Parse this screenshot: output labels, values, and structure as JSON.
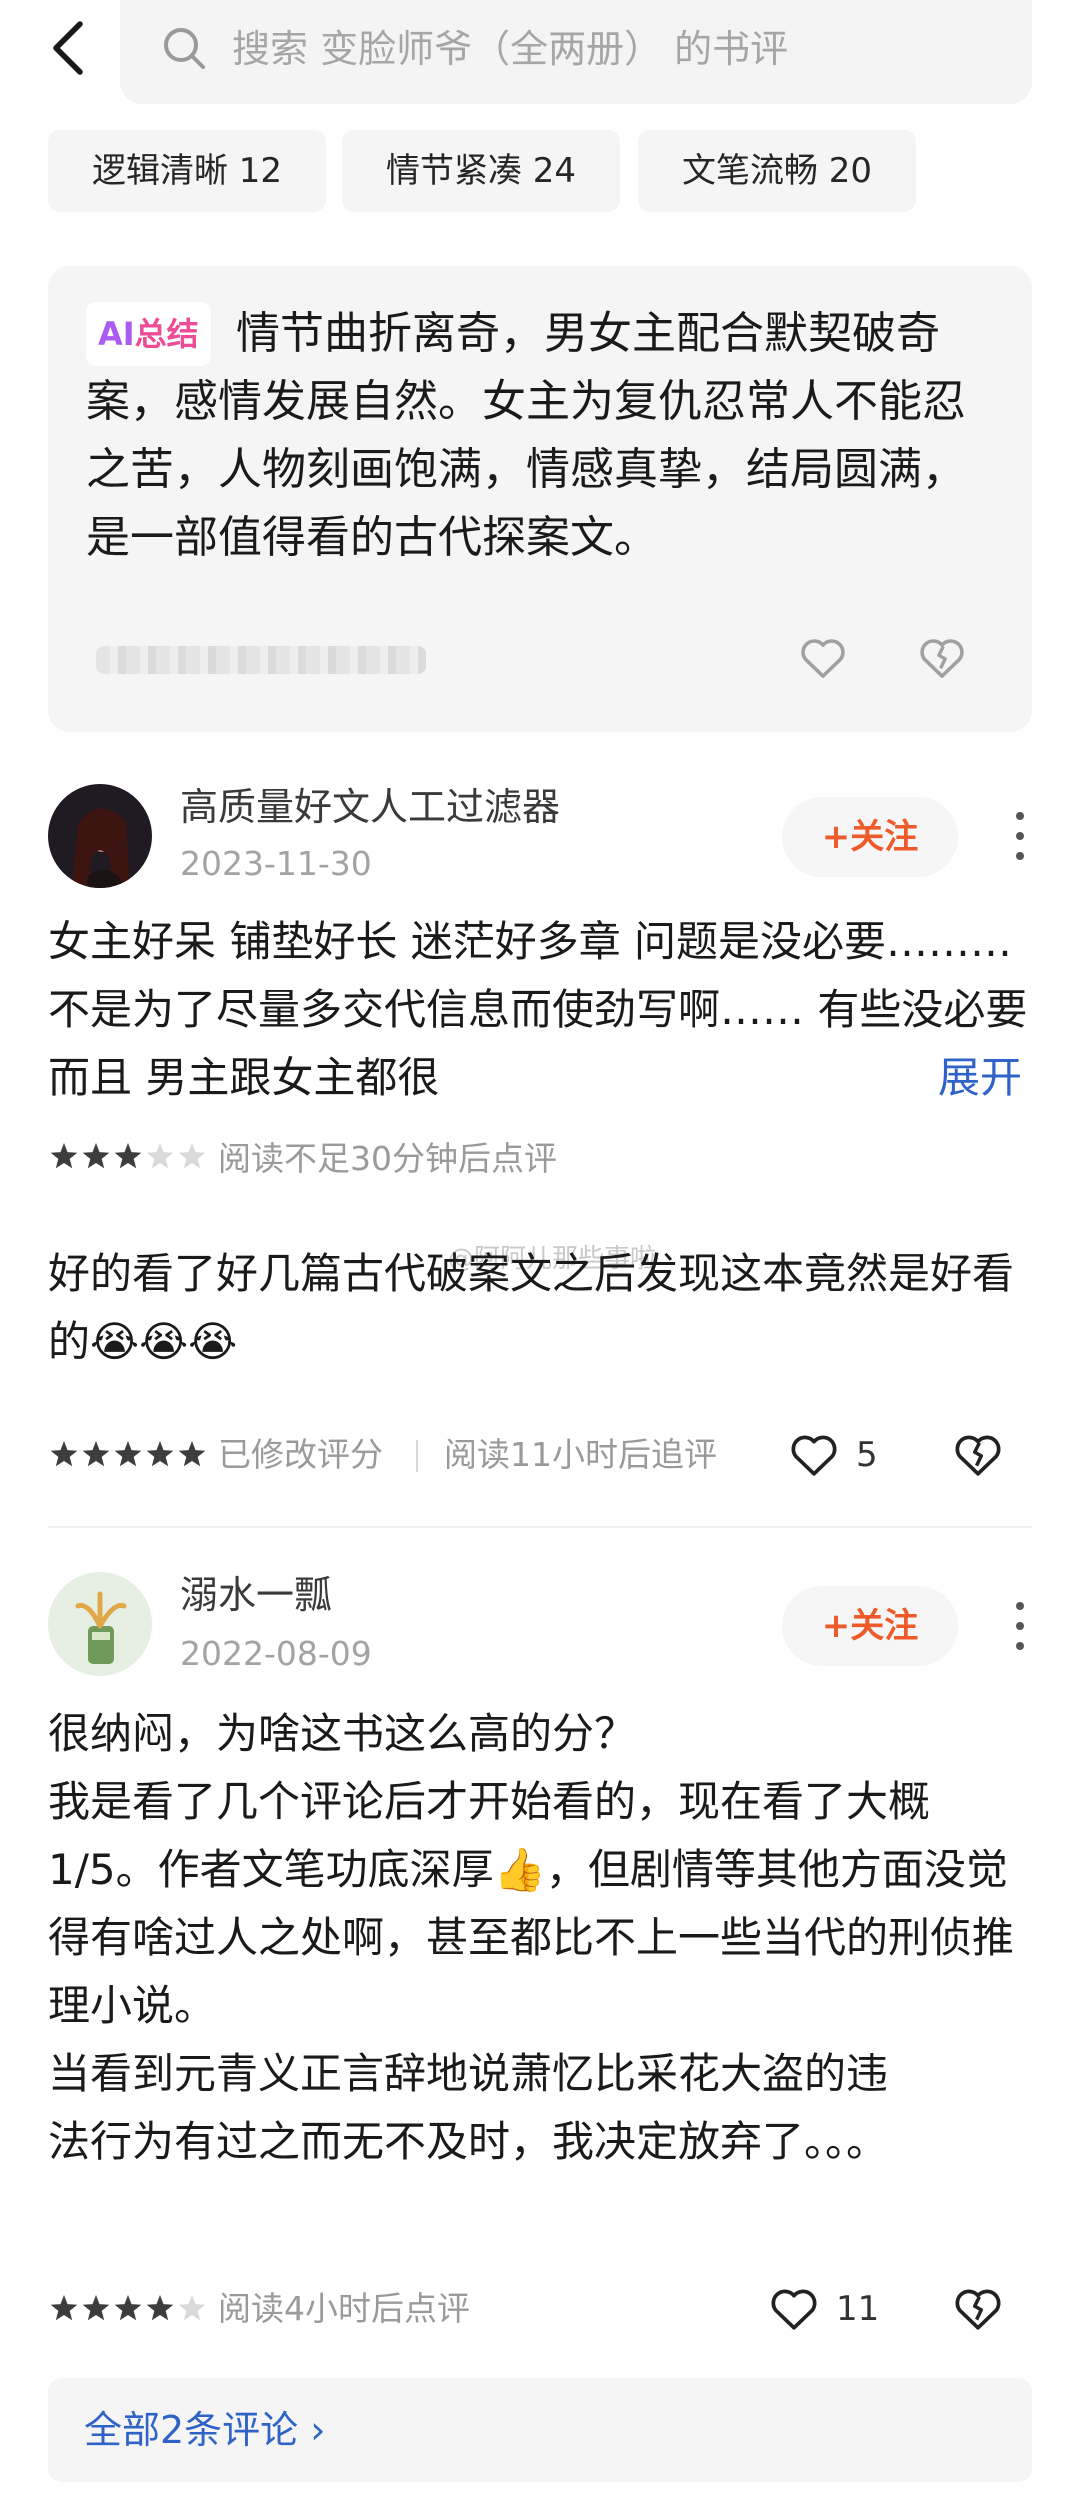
{
  "header": {
    "search_placeholder": "搜索 变脸师爷（全两册） 的书评"
  },
  "tags": [
    {
      "label": "逻辑清晰 12"
    },
    {
      "label": "情节紧凑 24"
    },
    {
      "label": "文笔流畅 20"
    }
  ],
  "ai_summary": {
    "badge_part1": "AI",
    "badge_part2": "总结",
    "text": "情节曲折离奇，男女主配合默契破奇案，感情发展自然。女主为复仇忍常人不能忍之苦，人物刻画饱满，情感真挚，结局圆满，是一部值得看的古代探案文。"
  },
  "reviews": [
    {
      "username": "高质量好文人工过滤器",
      "date": "2023-11-30",
      "follow_label": "+关注",
      "body": "女主好呆  铺垫好长  迷茫好多章  问题是没必要……… 不是为了尽量多交代信息而使劲写啊…… 有些没必要    而且  男主跟女主都很",
      "expand_label": "展开",
      "rating": 3,
      "read_note": "阅读不足30分钟后点评",
      "followup_text": "好的看了好几篇古代破案文之后发现这本竟然是好看的",
      "followup_emoji": "😭😭😭",
      "followup_rating": 5,
      "followup_note1": "已修改评分",
      "followup_note2": "阅读11小时后追评",
      "like_count": "5"
    },
    {
      "username": "溺水一瓢",
      "date": "2022-08-09",
      "follow_label": "+关注",
      "body_lines": [
        "很纳闷，为啥这书这么高的分？",
        "我是看了几个评论后才开始看的，现在看了大概1/5。作者文笔功底深厚👍，但剧情等其他方面没觉得有啥过人之处啊，甚至都比不上一些当代的刑侦推理小说。",
        "当看到元青义正言辞地说萧忆比采花大盗的违法行为有过之而无不及时，我决定放弃了。。。"
      ],
      "rating": 4,
      "read_note": "阅读4小时后点评",
      "like_count": "11"
    }
  ],
  "footer": {
    "all_comments_label": "全部2条评论 ›"
  },
  "watermark": "@阿阿儿那些事啦"
}
